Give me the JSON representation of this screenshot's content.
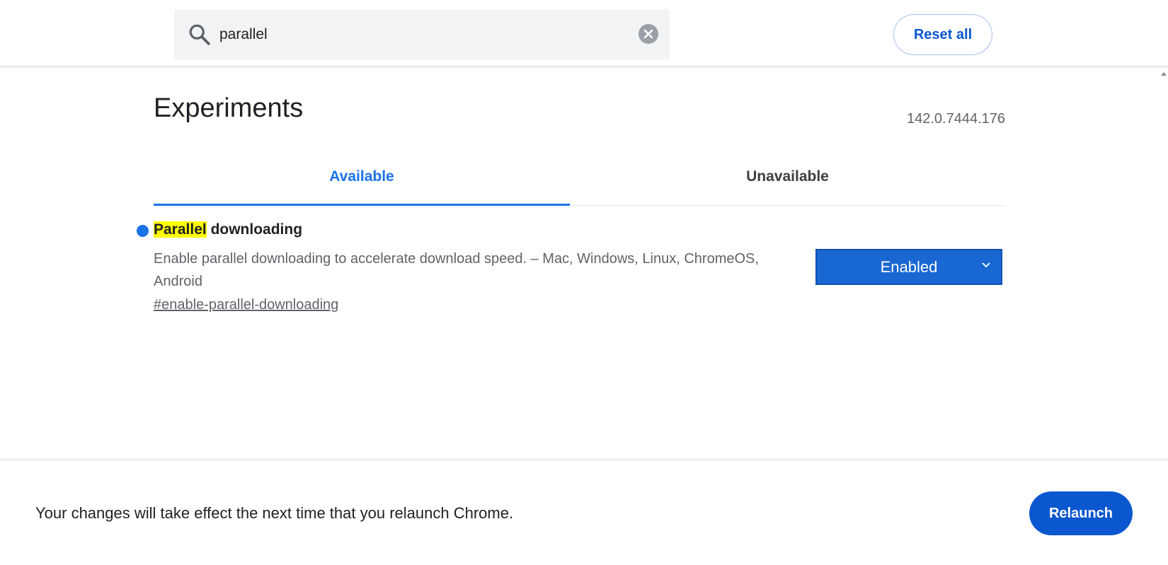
{
  "search": {
    "value": "parallel",
    "clear_icon": "close-circle-icon",
    "icon": "search-icon"
  },
  "header": {
    "reset_all_label": "Reset all"
  },
  "page": {
    "title": "Experiments",
    "version": "142.0.7444.176"
  },
  "tabs": [
    {
      "label": "Available",
      "active": true
    },
    {
      "label": "Unavailable",
      "active": false
    }
  ],
  "experiment": {
    "name_highlight": "Parallel",
    "name_rest": " downloading",
    "description": "Enable parallel downloading to accelerate download speed. – Mac, Windows, Linux, ChromeOS, Android",
    "link": "#enable-parallel-downloading",
    "selected_option": "Enabled"
  },
  "footer": {
    "message": "Your changes will take effect the next time that you relaunch Chrome.",
    "relaunch_label": "Relaunch"
  },
  "colors": {
    "accent": "#1a73e8",
    "button": "#0b57d0",
    "highlight": "#ffff00"
  }
}
